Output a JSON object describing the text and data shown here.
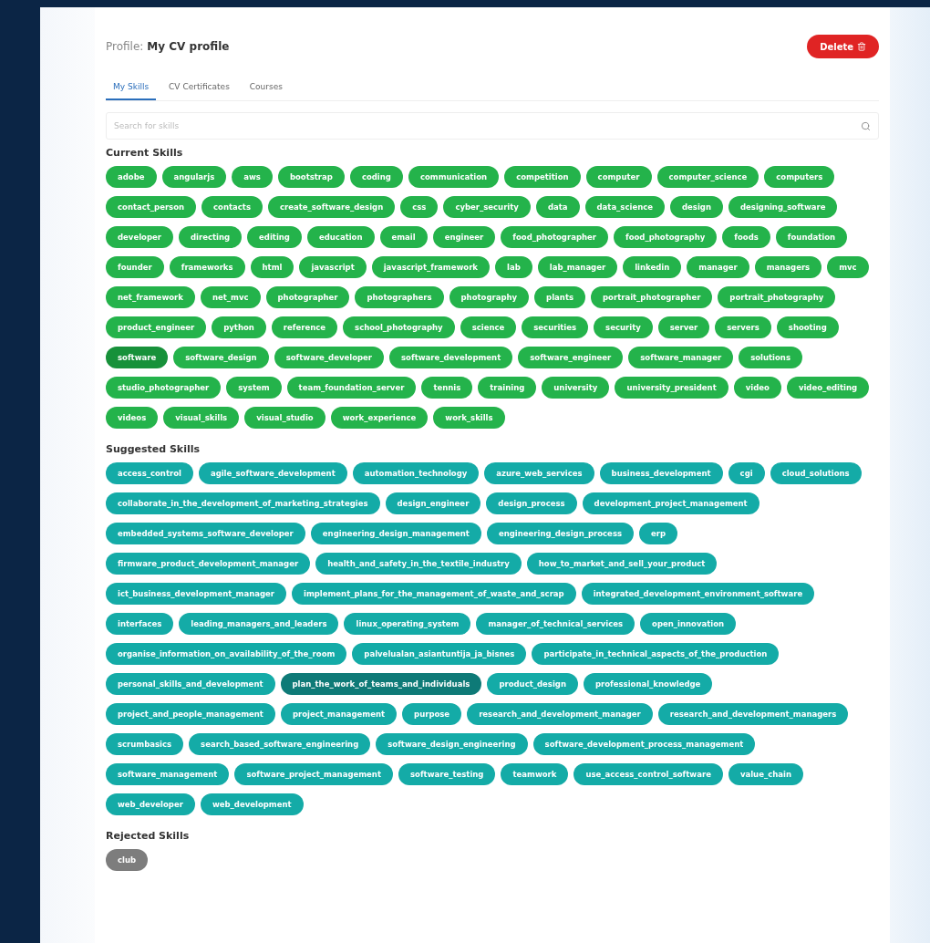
{
  "header": {
    "prefix": "Profile:",
    "title": "My CV profile",
    "delete_button": "Delete"
  },
  "tabs": [
    {
      "label": "My Skills",
      "selected": true
    },
    {
      "label": "CV Certificates",
      "selected": false
    },
    {
      "label": "Courses",
      "selected": false
    }
  ],
  "search": {
    "placeholder": "Search for skills"
  },
  "sections": [
    {
      "kind": "current",
      "title": "Current Skills",
      "skills": [
        {
          "label": "adobe",
          "highlighted": false
        },
        {
          "label": "angularjs",
          "highlighted": false
        },
        {
          "label": "aws",
          "highlighted": false
        },
        {
          "label": "bootstrap",
          "highlighted": false
        },
        {
          "label": "coding",
          "highlighted": false
        },
        {
          "label": "communication",
          "highlighted": false
        },
        {
          "label": "competition",
          "highlighted": false
        },
        {
          "label": "computer",
          "highlighted": false
        },
        {
          "label": "computer_science",
          "highlighted": false
        },
        {
          "label": "computers",
          "highlighted": false
        },
        {
          "label": "contact_person",
          "highlighted": false
        },
        {
          "label": "contacts",
          "highlighted": false
        },
        {
          "label": "create_software_design",
          "highlighted": false
        },
        {
          "label": "css",
          "highlighted": false
        },
        {
          "label": "cyber_security",
          "highlighted": false
        },
        {
          "label": "data",
          "highlighted": false
        },
        {
          "label": "data_science",
          "highlighted": false
        },
        {
          "label": "design",
          "highlighted": false
        },
        {
          "label": "designing_software",
          "highlighted": false
        },
        {
          "label": "developer",
          "highlighted": false
        },
        {
          "label": "directing",
          "highlighted": false
        },
        {
          "label": "editing",
          "highlighted": false
        },
        {
          "label": "education",
          "highlighted": false
        },
        {
          "label": "email",
          "highlighted": false
        },
        {
          "label": "engineer",
          "highlighted": false
        },
        {
          "label": "food_photographer",
          "highlighted": false
        },
        {
          "label": "food_photography",
          "highlighted": false
        },
        {
          "label": "foods",
          "highlighted": false
        },
        {
          "label": "foundation",
          "highlighted": false
        },
        {
          "label": "founder",
          "highlighted": false
        },
        {
          "label": "frameworks",
          "highlighted": false
        },
        {
          "label": "html",
          "highlighted": false
        },
        {
          "label": "javascript",
          "highlighted": false
        },
        {
          "label": "javascript_framework",
          "highlighted": false
        },
        {
          "label": "lab",
          "highlighted": false
        },
        {
          "label": "lab_manager",
          "highlighted": false
        },
        {
          "label": "linkedin",
          "highlighted": false
        },
        {
          "label": "manager",
          "highlighted": false
        },
        {
          "label": "managers",
          "highlighted": false
        },
        {
          "label": "mvc",
          "highlighted": false
        },
        {
          "label": "net_framework",
          "highlighted": false
        },
        {
          "label": "net_mvc",
          "highlighted": false
        },
        {
          "label": "photographer",
          "highlighted": false
        },
        {
          "label": "photographers",
          "highlighted": false
        },
        {
          "label": "photography",
          "highlighted": false
        },
        {
          "label": "plants",
          "highlighted": false
        },
        {
          "label": "portrait_photographer",
          "highlighted": false
        },
        {
          "label": "portrait_photography",
          "highlighted": false
        },
        {
          "label": "product_engineer",
          "highlighted": false
        },
        {
          "label": "python",
          "highlighted": false
        },
        {
          "label": "reference",
          "highlighted": false
        },
        {
          "label": "school_photography",
          "highlighted": false
        },
        {
          "label": "science",
          "highlighted": false
        },
        {
          "label": "securities",
          "highlighted": false
        },
        {
          "label": "security",
          "highlighted": false
        },
        {
          "label": "server",
          "highlighted": false
        },
        {
          "label": "servers",
          "highlighted": false
        },
        {
          "label": "shooting",
          "highlighted": false
        },
        {
          "label": "software",
          "highlighted": true
        },
        {
          "label": "software_design",
          "highlighted": false
        },
        {
          "label": "software_developer",
          "highlighted": false
        },
        {
          "label": "software_development",
          "highlighted": false
        },
        {
          "label": "software_engineer",
          "highlighted": false
        },
        {
          "label": "software_manager",
          "highlighted": false
        },
        {
          "label": "solutions",
          "highlighted": false
        },
        {
          "label": "studio_photographer",
          "highlighted": false
        },
        {
          "label": "system",
          "highlighted": false
        },
        {
          "label": "team_foundation_server",
          "highlighted": false
        },
        {
          "label": "tennis",
          "highlighted": false
        },
        {
          "label": "training",
          "highlighted": false
        },
        {
          "label": "university",
          "highlighted": false
        },
        {
          "label": "university_president",
          "highlighted": false
        },
        {
          "label": "video",
          "highlighted": false
        },
        {
          "label": "video_editing",
          "highlighted": false
        },
        {
          "label": "videos",
          "highlighted": false
        },
        {
          "label": "visual_skills",
          "highlighted": false
        },
        {
          "label": "visual_studio",
          "highlighted": false
        },
        {
          "label": "work_experience",
          "highlighted": false
        },
        {
          "label": "work_skills",
          "highlighted": false
        }
      ]
    },
    {
      "kind": "suggested",
      "title": "Suggested Skills",
      "skills": [
        {
          "label": "access_control",
          "highlighted": false
        },
        {
          "label": "agile_software_development",
          "highlighted": false
        },
        {
          "label": "automation_technology",
          "highlighted": false
        },
        {
          "label": "azure_web_services",
          "highlighted": false
        },
        {
          "label": "business_development",
          "highlighted": false
        },
        {
          "label": "cgi",
          "highlighted": false
        },
        {
          "label": "cloud_solutions",
          "highlighted": false
        },
        {
          "label": "collaborate_in_the_development_of_marketing_strategies",
          "highlighted": false
        },
        {
          "label": "design_engineer",
          "highlighted": false
        },
        {
          "label": "design_process",
          "highlighted": false
        },
        {
          "label": "development_project_management",
          "highlighted": false
        },
        {
          "label": "embedded_systems_software_developer",
          "highlighted": false
        },
        {
          "label": "engineering_design_management",
          "highlighted": false
        },
        {
          "label": "engineering_design_process",
          "highlighted": false
        },
        {
          "label": "erp",
          "highlighted": false
        },
        {
          "label": "firmware_product_development_manager",
          "highlighted": false
        },
        {
          "label": "health_and_safety_in_the_textile_industry",
          "highlighted": false
        },
        {
          "label": "how_to_market_and_sell_your_product",
          "highlighted": false
        },
        {
          "label": "ict_business_development_manager",
          "highlighted": false
        },
        {
          "label": "implement_plans_for_the_management_of_waste_and_scrap",
          "highlighted": false
        },
        {
          "label": "integrated_development_environment_software",
          "highlighted": false
        },
        {
          "label": "interfaces",
          "highlighted": false
        },
        {
          "label": "leading_managers_and_leaders",
          "highlighted": false
        },
        {
          "label": "linux_operating_system",
          "highlighted": false
        },
        {
          "label": "manager_of_technical_services",
          "highlighted": false
        },
        {
          "label": "open_innovation",
          "highlighted": false
        },
        {
          "label": "organise_information_on_availability_of_the_room",
          "highlighted": false
        },
        {
          "label": "palvelualan_asiantuntija_ja_bisnes",
          "highlighted": false
        },
        {
          "label": "participate_in_technical_aspects_of_the_production",
          "highlighted": false
        },
        {
          "label": "personal_skills_and_development",
          "highlighted": false
        },
        {
          "label": "plan_the_work_of_teams_and_individuals",
          "highlighted": true
        },
        {
          "label": "product_design",
          "highlighted": false
        },
        {
          "label": "professional_knowledge",
          "highlighted": false
        },
        {
          "label": "project_and_people_management",
          "highlighted": false
        },
        {
          "label": "project_management",
          "highlighted": false
        },
        {
          "label": "purpose",
          "highlighted": false
        },
        {
          "label": "research_and_development_manager",
          "highlighted": false
        },
        {
          "label": "research_and_development_managers",
          "highlighted": false
        },
        {
          "label": "scrumbasics",
          "highlighted": false
        },
        {
          "label": "search_based_software_engineering",
          "highlighted": false
        },
        {
          "label": "software_design_engineering",
          "highlighted": false
        },
        {
          "label": "software_development_process_management",
          "highlighted": false
        },
        {
          "label": "software_management",
          "highlighted": false
        },
        {
          "label": "software_project_management",
          "highlighted": false
        },
        {
          "label": "software_testing",
          "highlighted": false
        },
        {
          "label": "teamwork",
          "highlighted": false
        },
        {
          "label": "use_access_control_software",
          "highlighted": false
        },
        {
          "label": "value_chain",
          "highlighted": false
        },
        {
          "label": "web_developer",
          "highlighted": false
        },
        {
          "label": "web_development",
          "highlighted": false
        }
      ]
    },
    {
      "kind": "rejected",
      "title": "Rejected Skills",
      "skills": [
        {
          "label": "club",
          "highlighted": false
        }
      ]
    }
  ]
}
